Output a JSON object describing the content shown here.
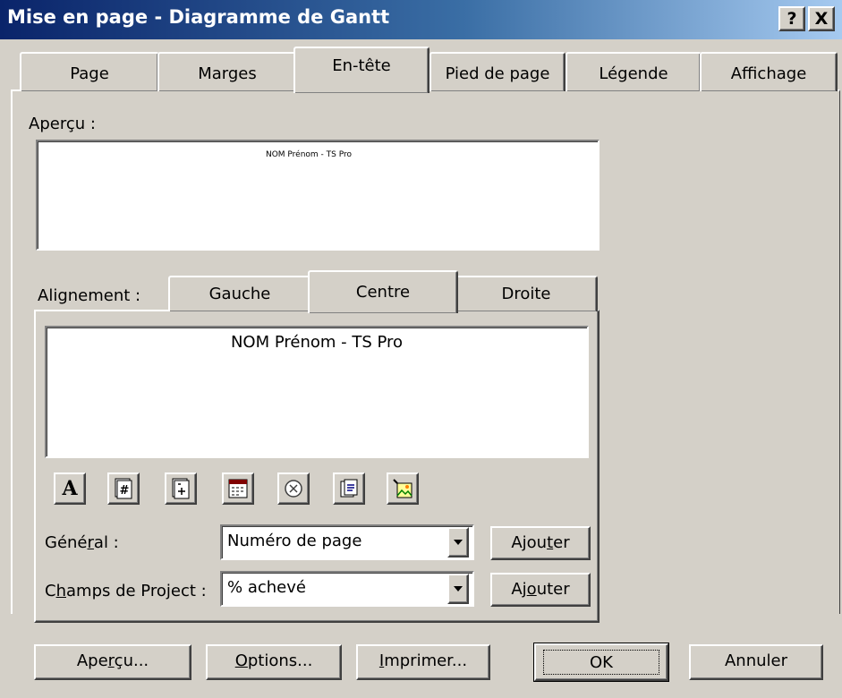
{
  "window": {
    "title": "Mise en page - Diagramme de Gantt",
    "help_label": "?",
    "close_label": "X"
  },
  "tabs": [
    {
      "label": "Page"
    },
    {
      "label": "Marges"
    },
    {
      "label": "En-tête"
    },
    {
      "label": "Pied de page"
    },
    {
      "label": "Légende"
    },
    {
      "label": "Affichage"
    }
  ],
  "active_tab": "En-tête",
  "preview": {
    "label": "Aperçu :",
    "text": "NOM Prénom - TS Pro"
  },
  "alignment": {
    "label": "Alignement :",
    "tabs": [
      {
        "label": "Gauche"
      },
      {
        "label": "Centre"
      },
      {
        "label": "Droite"
      }
    ],
    "active": "Centre",
    "editor_text": "NOM Prénom - TS Pro"
  },
  "toolbar": {
    "icons": [
      "format-text-icon",
      "page-number-icon",
      "total-pages-icon",
      "date-icon",
      "time-icon",
      "file-name-icon",
      "insert-picture-icon"
    ],
    "font_glyph": "A"
  },
  "general": {
    "label_pre": "Géné",
    "label_key": "r",
    "label_post": "al :",
    "value": "Numéro de page",
    "button_pre": "Ajou",
    "button_key": "t",
    "button_post": "er"
  },
  "project_fields": {
    "label_pre": "C",
    "label_key": "h",
    "label_post": "amps de Project :",
    "value": "% achevé",
    "button_pre": "Aj",
    "button_key": "o",
    "button_post": "uter"
  },
  "footer": {
    "preview": {
      "pre": "Ape",
      "key": "r",
      "post": "çu..."
    },
    "options": {
      "pre": "",
      "key": "O",
      "post": "ptions..."
    },
    "print": {
      "pre": "",
      "key": "I",
      "post": "mprimer..."
    },
    "ok": "OK",
    "cancel": "Annuler"
  },
  "colors": {
    "face": "#d4d0c8",
    "title_start": "#0a246a",
    "title_end": "#a6caf0"
  }
}
